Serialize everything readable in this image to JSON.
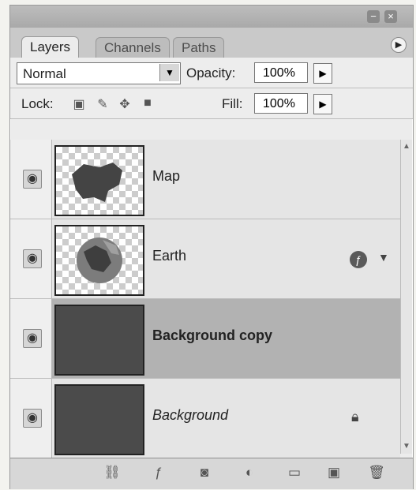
{
  "panel": {
    "tabs": [
      "Layers",
      "Channels",
      "Paths"
    ],
    "blend_mode": "Normal",
    "opacity_label": "Opacity:",
    "opacity_value": "100%",
    "lock_label": "Lock:",
    "fill_label": "Fill:",
    "fill_value": "100%"
  },
  "layers": [
    {
      "name": "Map"
    },
    {
      "name": "Earth"
    },
    {
      "name": "Background copy"
    },
    {
      "name": "Background"
    }
  ],
  "icons": {
    "window_minimize": "minimize-icon",
    "window_close": "close-icon",
    "panel_menu": "panel-menu-icon",
    "visibility": "eye-icon",
    "effects": "fx-icon",
    "lock": "lock-icon"
  }
}
